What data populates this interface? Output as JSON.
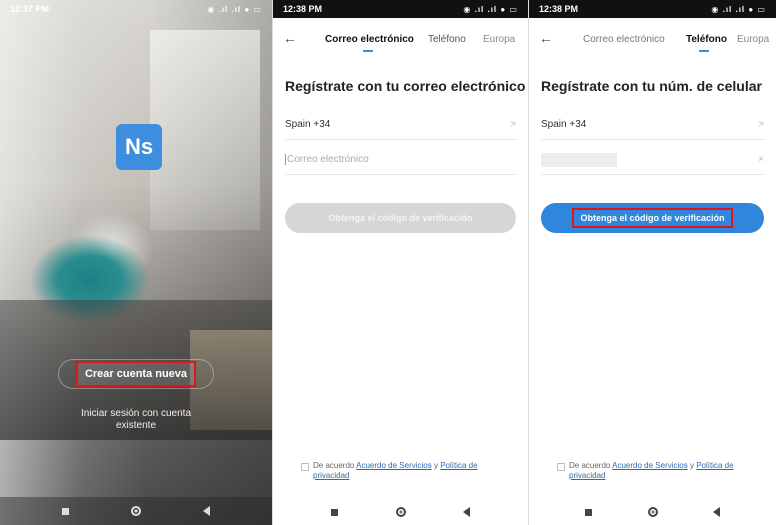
{
  "screen1": {
    "status_time": "12:37 PM",
    "status_icons": "◉ .ıl .ıl ● ▭",
    "logo_text": "Ns",
    "create_account_label": "Crear cuenta nueva",
    "login_existing_label": "Iniciar sesión con cuenta existente"
  },
  "screen2": {
    "status_time": "12:38 PM",
    "status_icons": "◉ .ıl .ıl ● ▭",
    "tabs": [
      "Correo electrónico",
      "Teléfono",
      "Europa"
    ],
    "active_tab": "Correo electrónico",
    "title": "Regístrate con tu correo electrónico",
    "country_value": "Spain +34",
    "email_placeholder": "Correo electrónico",
    "verify_label": "Obtenga el código de verificación",
    "agree_prefix": "De acuerdo",
    "agree_terms": "Acuerdo de Servicios",
    "agree_and": "y",
    "agree_privacy": "Política de privacidad"
  },
  "screen3": {
    "status_time": "12:38 PM",
    "status_icons": "◉ .ıl .ıl ● ▭",
    "tabs": [
      "Correo electrónico",
      "Teléfono",
      "Europa"
    ],
    "active_tab": "Teléfono",
    "title": "Regístrate con tu núm. de celular",
    "country_value": "Spain +34",
    "clear_symbol": "×",
    "verify_label": "Obtenga el código de verificación",
    "agree_prefix": "De acuerdo",
    "agree_terms": "Acuerdo de Servicios",
    "agree_and": "y",
    "agree_privacy": "Política de privacidad"
  },
  "icons": {
    "back": "arrow-left-icon",
    "chevron": "chevron-right-icon",
    "nav_recents": "square-icon",
    "nav_home": "circle-icon",
    "nav_back": "triangle-back-icon"
  },
  "colors": {
    "accent": "#2f86db",
    "highlight_box": "#e0141e",
    "logo_bg": "#3e8ee0",
    "disabled_button": "#d6d6d6"
  }
}
